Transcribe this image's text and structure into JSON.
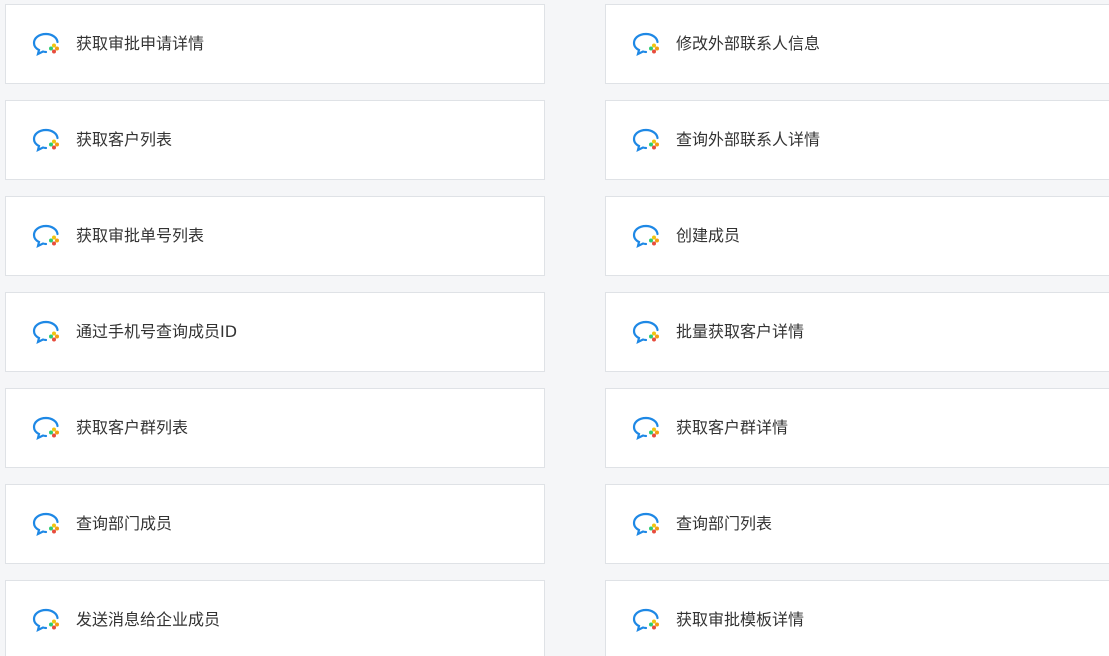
{
  "cards": [
    {
      "label": "获取审批申请详情",
      "icon": "wecom-chat-icon"
    },
    {
      "label": "修改外部联系人信息",
      "icon": "wecom-chat-icon"
    },
    {
      "label": "获取客户列表",
      "icon": "wecom-chat-icon"
    },
    {
      "label": "查询外部联系人详情",
      "icon": "wecom-chat-icon"
    },
    {
      "label": "获取审批单号列表",
      "icon": "wecom-chat-icon"
    },
    {
      "label": "创建成员",
      "icon": "wecom-chat-icon"
    },
    {
      "label": "通过手机号查询成员ID",
      "icon": "wecom-chat-icon"
    },
    {
      "label": "批量获取客户详情",
      "icon": "wecom-chat-icon"
    },
    {
      "label": "获取客户群列表",
      "icon": "wecom-chat-icon"
    },
    {
      "label": "获取客户群详情",
      "icon": "wecom-chat-icon"
    },
    {
      "label": "查询部门成员",
      "icon": "wecom-chat-icon"
    },
    {
      "label": "查询部门列表",
      "icon": "wecom-chat-icon"
    },
    {
      "label": "发送消息给企业成员",
      "icon": "wecom-chat-icon"
    },
    {
      "label": "获取审批模板详情",
      "icon": "wecom-chat-icon"
    }
  ],
  "colors": {
    "icon_blue": "#1e88e5",
    "icon_orange": "#f39c12",
    "icon_red": "#e74c3c",
    "icon_green": "#2ecc71",
    "icon_yellow": "#f1c40f"
  }
}
